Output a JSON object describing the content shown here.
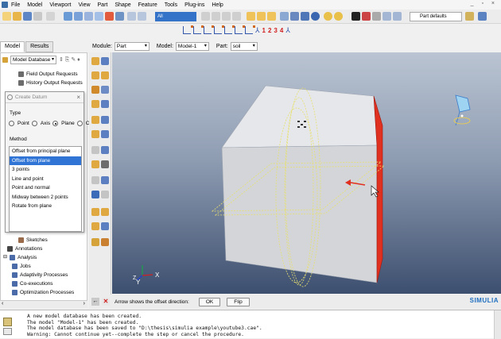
{
  "menu": {
    "items": [
      "File",
      "Model",
      "Viewport",
      "View",
      "Part",
      "Shape",
      "Feature",
      "Tools",
      "Plug-ins",
      "Help"
    ],
    "window_controls": "_ ▫ ×"
  },
  "toolbar": {
    "view_select": "All",
    "part_defaults": "Part defaults",
    "csys_numbers": [
      "1",
      "2",
      "3",
      "4"
    ]
  },
  "tabs": [
    "Model",
    "Results"
  ],
  "module_bar": {
    "module_label": "Module:",
    "module_value": "Part",
    "model_label": "Model:",
    "model_value": "Model-1",
    "part_label": "Part:",
    "part_value": "soil"
  },
  "tree": {
    "header": "Model Database",
    "items_top": [
      "Field Output Requests",
      "History Output Requests"
    ],
    "items_bottom": [
      "Sketches",
      "Annotations",
      "Analysis",
      "Jobs",
      "Adaptivity Processes",
      "Co-executions",
      "Optimization Processes"
    ]
  },
  "dialog": {
    "title": "Create Datum",
    "type_label": "Type",
    "radios": [
      "Point",
      "Axis",
      "Plane",
      "CSYS"
    ],
    "selected_radio": "Plane",
    "method_label": "Method",
    "methods": [
      "Offset from principal plane",
      "Offset from plane",
      "3 points",
      "Line and point",
      "Point and normal",
      "Midway between 2 points",
      "Rotate from plane"
    ],
    "selected_method": "Offset from plane"
  },
  "viewport": {
    "axis_labels": [
      "Y",
      "X",
      "Z"
    ]
  },
  "prompt": {
    "back_icon": "arrow-left",
    "cancel_icon": "close-x",
    "text": "Arrow shows the offset direction:",
    "ok_label": "OK",
    "flip_label": "Flip",
    "brand": "SIMULIA"
  },
  "messages": [
    "A new model database has been created.",
    "The model \"Model-1\" has been created.",
    "The model database has been saved to \"D:\\thesis\\simulia example\\youtube3.cae\".",
    "Warning: Cannot continue yet--complete the step or cancel the procedure."
  ],
  "colors": {
    "selection_blue": "#3075d6",
    "highlight_red": "#e03020",
    "datum_yellow": "#e8e070",
    "brand_blue": "#1f6fc0"
  }
}
